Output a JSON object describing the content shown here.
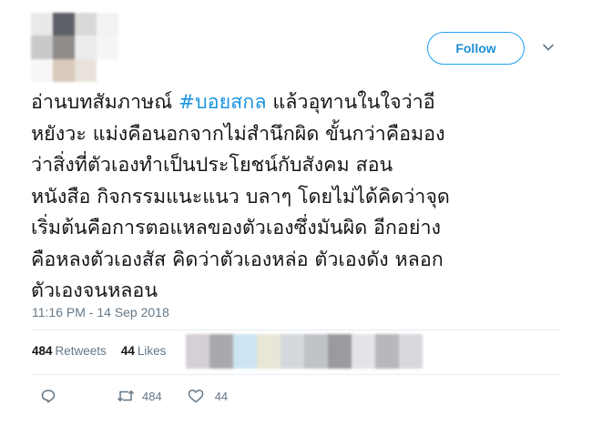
{
  "tweet": {
    "follow_label": "Follow",
    "hashtag": "#บอยสกล",
    "text_before_hashtag": "อ่านบทสัมภาษณ์ ",
    "text_after_hashtag": " แล้วอุทานในใจว่าอี\nหยังวะ แม่งคือนอกจากไม่สำนึกผิด ขั้นกว่าคือมอง\nว่าสิ่งที่ตัวเองทำเป็นประโยชน์กับสังคม สอน\nหนังสือ กิจกรรมแนะแนว บลาๆ โดยไม่ได้คิดว่าจุด\nเริ่มต้นคือการตอแหลของตัวเองซึ่งมันผิด อีกอย่าง\nคือหลงตัวเองสัส คิดว่าตัวเองหล่อ ตัวเองดัง หลอก\nตัวเองจนหลอน",
    "timestamp": "11:16 PM - 14 Sep 2018",
    "retweets_count": "484",
    "retweets_label": "Retweets",
    "likes_count": "44",
    "likes_label": "Likes",
    "action_retweet_count": "484",
    "action_like_count": "44"
  },
  "icons": {
    "reply": "reply-icon",
    "retweet": "retweet-icon",
    "like": "heart-icon",
    "more": "chevron-down-icon"
  },
  "colors": {
    "accent": "#1da1f2",
    "hashtag": "#1b95e0",
    "muted": "#657786",
    "text": "#14171a"
  }
}
